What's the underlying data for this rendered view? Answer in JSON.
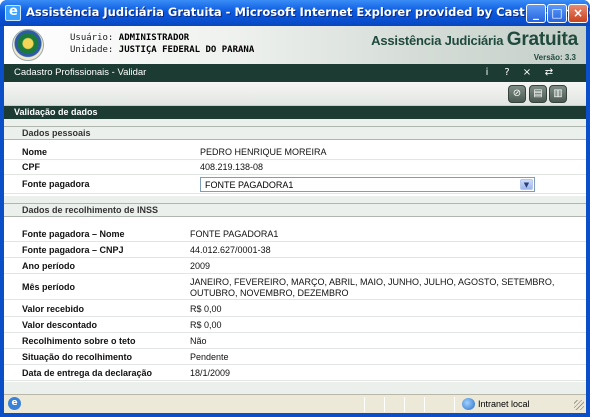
{
  "window": {
    "title": "Assistência Judiciária Gratuita - Microsoft Internet Explorer provided by Cast Informatica SA"
  },
  "header": {
    "user_label": "Usuário:",
    "user_value": "ADMINISTRADOR",
    "unit_label": "Unidade:",
    "unit_value": "JUSTIÇA FEDERAL DO PARANA",
    "brand_prefix": "Assistência Judiciária",
    "brand_main": "Gratuita",
    "version": "Versão: 3.3"
  },
  "nav": {
    "breadcrumb": "Cadastro Profissionais - Validar",
    "icons": [
      "info-icon",
      "help-icon",
      "close-icon",
      "swap-icon"
    ],
    "icon_glyphs": [
      "i",
      "?",
      "×",
      "⇄"
    ]
  },
  "toolbar": {
    "icons": [
      "cancel-icon",
      "document-icon",
      "document-pdf-icon"
    ],
    "icon_glyphs": [
      "⊘",
      "▤",
      "▥"
    ]
  },
  "section": {
    "title": "Validação de dados"
  },
  "personal": {
    "heading": "Dados pessoais",
    "rows": [
      {
        "label": "Nome",
        "value": "PEDRO HENRIQUE MOREIRA"
      },
      {
        "label": "CPF",
        "value": "408.219.138-08"
      }
    ],
    "payer_label": "Fonte pagadora",
    "payer_selected": "FONTE PAGADORA1"
  },
  "inss": {
    "heading": "Dados de recolhimento de INSS",
    "rows": [
      {
        "label": "Fonte pagadora – Nome",
        "value": "FONTE PAGADORA1"
      },
      {
        "label": "Fonte pagadora – CNPJ",
        "value": "44.012.627/0001-38"
      },
      {
        "label": "Ano período",
        "value": "2009"
      },
      {
        "label": "Mês período",
        "value": "JANEIRO, FEVEREIRO, MARÇO, ABRIL, MAIO, JUNHO, JULHO, AGOSTO, SETEMBRO, OUTUBRO, NOVEMBRO, DEZEMBRO"
      },
      {
        "label": "Valor recebido",
        "value": "R$ 0,00"
      },
      {
        "label": "Valor descontado",
        "value": "R$ 0,00"
      },
      {
        "label": "Recolhimento sobre o teto",
        "value": "Não"
      },
      {
        "label": "Situação do recolhimento",
        "value": "Pendente"
      },
      {
        "label": "Data de entrega da declaração",
        "value": "18/1/2009"
      }
    ]
  },
  "statusbar": {
    "zone": "Intranet local"
  },
  "colors": {
    "titlebar": "#0a4fd0",
    "nav_dark": "#1c3b33",
    "band": "#ecf0ec"
  }
}
